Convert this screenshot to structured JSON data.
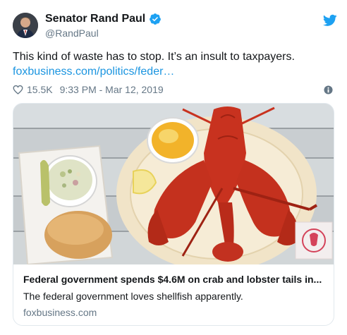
{
  "author": {
    "display_name": "Senator Rand Paul",
    "handle": "@RandPaul",
    "verified_icon": "verified-badge-icon"
  },
  "tweet": {
    "text": "This kind of waste has to stop. It’s an insult to taxpayers.",
    "link_text": "foxbusiness.com/politics/feder…",
    "likes": "15.5K",
    "timestamp": "9:33 PM - Mar 12, 2019"
  },
  "card": {
    "title": "Federal government spends $4.6M on crab and lobster tails in...",
    "description": "The federal government loves shellfish apparently.",
    "domain": "foxbusiness.com"
  },
  "colors": {
    "link": "#1b95e0",
    "twitter_blue": "#1da1f2",
    "muted": "#657786",
    "border": "#e1e8ed",
    "lobster_red": "#c8321f"
  }
}
